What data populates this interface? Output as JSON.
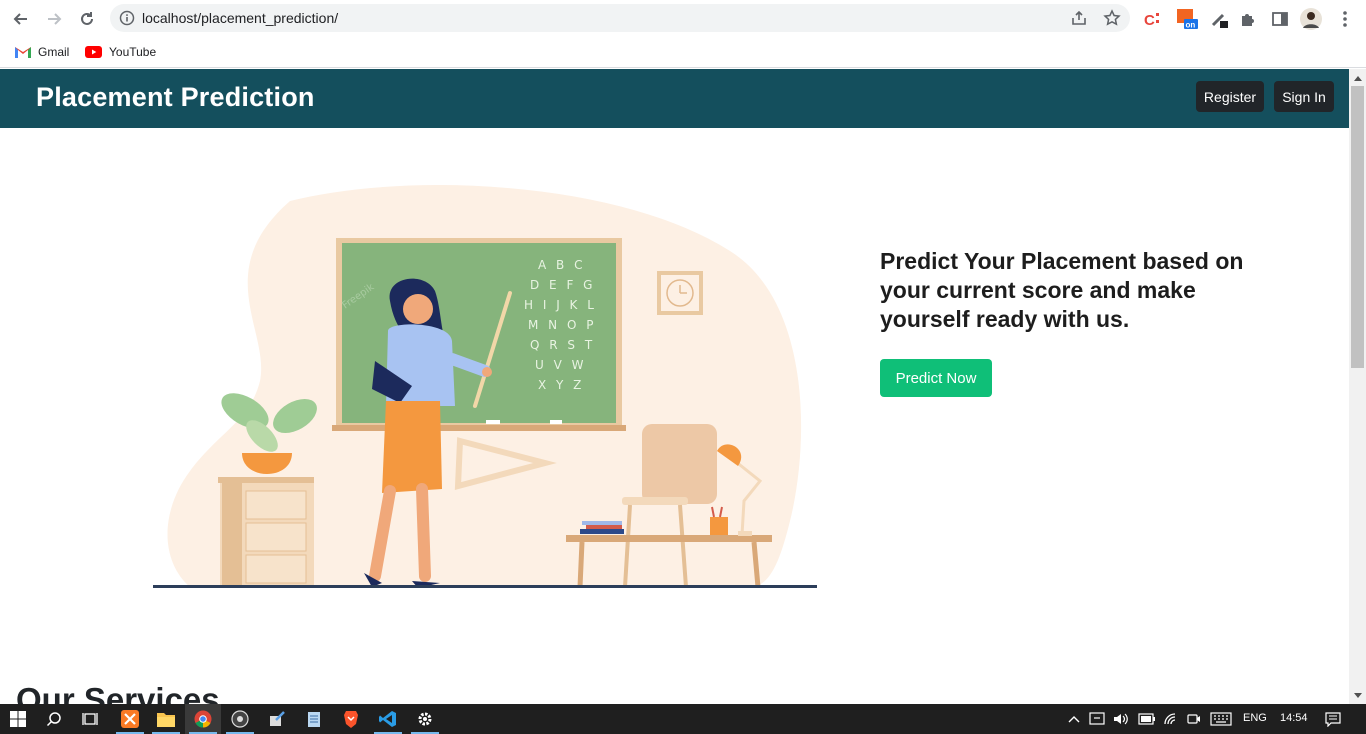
{
  "browser": {
    "url": "localhost/placement_prediction/",
    "bookmarks": [
      {
        "label": "Gmail",
        "icon": "gmail-icon"
      },
      {
        "label": "YouTube",
        "icon": "youtube-icon"
      }
    ]
  },
  "navbar": {
    "brand": "Placement Prediction",
    "register_label": "Register",
    "signin_label": "Sign In",
    "background": "#144f5d"
  },
  "hero": {
    "headline": "Predict Your Placement based on your current score and make yourself ready with us.",
    "cta_label": "Predict Now",
    "cta_color": "#0fbf78",
    "illustration": "teacher-at-chalkboard-illustration",
    "board_letters": [
      "A B C",
      "D E F G",
      "H I J K L",
      "M N O P",
      "Q R S T",
      "U V W",
      "X Y Z"
    ],
    "watermark": "Freepik"
  },
  "services": {
    "heading": "Our Services"
  },
  "taskbar": {
    "language": "ENG",
    "time": "14:54"
  }
}
